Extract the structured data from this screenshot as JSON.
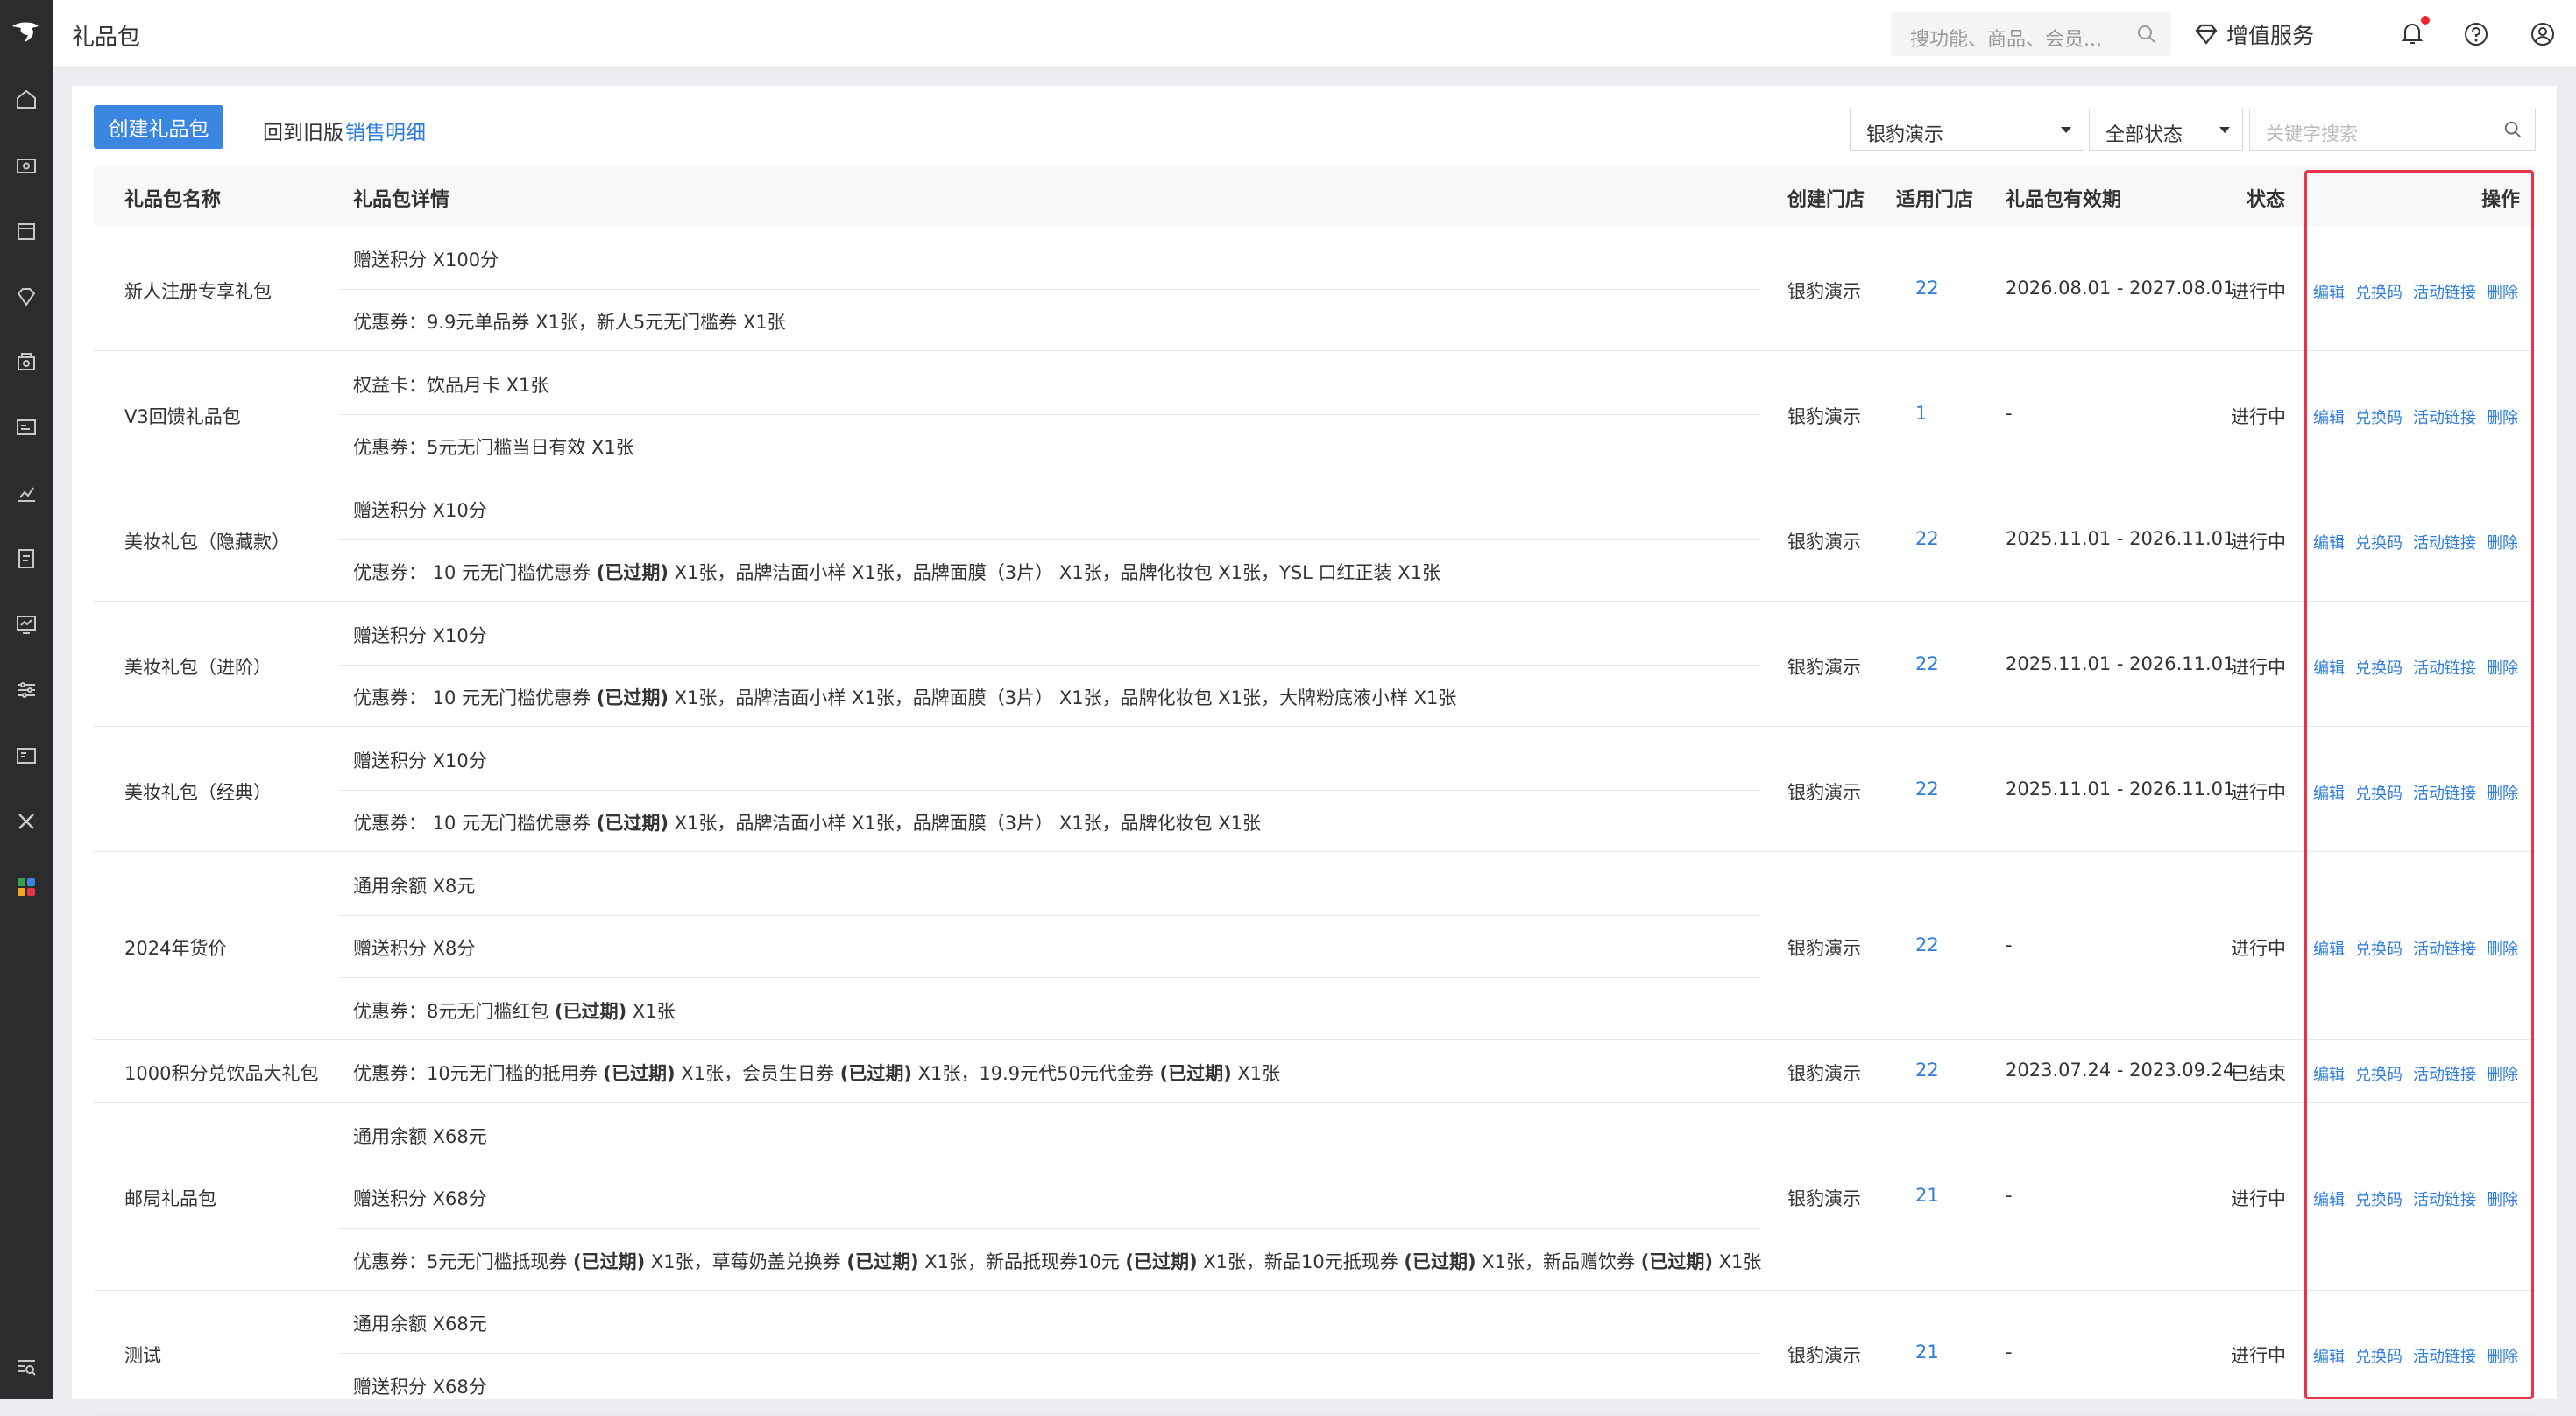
{
  "topbar": {
    "title": "礼品包",
    "search_placeholder": "搜功能、商品、会员...",
    "value_added": "增值服务"
  },
  "toolbar": {
    "create_button": "创建礼品包",
    "back_old": "回到旧版",
    "sales_detail": "销售明细",
    "store_select": "银豹演示",
    "status_select": "全部状态",
    "keyword_placeholder": "关键字搜索"
  },
  "table": {
    "headers": {
      "name": "礼品包名称",
      "detail": "礼品包详情",
      "creator_store": "创建门店",
      "applicable_stores": "适用门店",
      "validity": "礼品包有效期",
      "status": "状态",
      "actions": "操作"
    },
    "action_labels": [
      "编辑",
      "兑换码",
      "活动链接",
      "删除"
    ],
    "rows": [
      {
        "name": "新人注册专享礼包",
        "details": [
          "赠送积分 X100分",
          "优惠券：9.9元单品券 X1张，新人5元无门槛券 X1张"
        ],
        "creator": "银豹演示",
        "stores": "22",
        "validity": "2026.08.01 - 2027.08.01",
        "status": "进行中"
      },
      {
        "name": "V3回馈礼品包",
        "details": [
          "权益卡：饮品月卡 X1张",
          "优惠券：5元无门槛当日有效 X1张"
        ],
        "creator": "银豹演示",
        "stores": "1",
        "validity": "-",
        "status": "进行中"
      },
      {
        "name": "美妆礼包（隐藏款）",
        "details": [
          "赠送积分 X10分",
          "优惠券： 10 元无门槛优惠券 (已过期) X1张，品牌洁面小样 X1张，品牌面膜（3片） X1张，品牌化妆包 X1张，YSL 口红正装 X1张"
        ],
        "creator": "银豹演示",
        "stores": "22",
        "validity": "2025.11.01 - 2026.11.01",
        "status": "进行中"
      },
      {
        "name": "美妆礼包（进阶）",
        "details": [
          "赠送积分 X10分",
          "优惠券： 10 元无门槛优惠券 (已过期) X1张，品牌洁面小样 X1张，品牌面膜（3片） X1张，品牌化妆包 X1张，大牌粉底液小样 X1张"
        ],
        "creator": "银豹演示",
        "stores": "22",
        "validity": "2025.11.01 - 2026.11.01",
        "status": "进行中"
      },
      {
        "name": "美妆礼包（经典）",
        "details": [
          "赠送积分 X10分",
          "优惠券： 10 元无门槛优惠券 (已过期) X1张，品牌洁面小样 X1张，品牌面膜（3片） X1张，品牌化妆包 X1张"
        ],
        "creator": "银豹演示",
        "stores": "22",
        "validity": "2025.11.01 - 2026.11.01",
        "status": "进行中"
      },
      {
        "name": "2024年货价",
        "details": [
          "通用余额 X8元",
          "赠送积分 X8分",
          "优惠券：8元无门槛红包 (已过期) X1张"
        ],
        "creator": "银豹演示",
        "stores": "22",
        "validity": "-",
        "status": "进行中"
      },
      {
        "name": "1000积分兑饮品大礼包",
        "details": [
          "优惠券：10元无门槛的抵用券 (已过期) X1张，会员生日券 (已过期) X1张，19.9元代50元代金券 (已过期) X1张"
        ],
        "creator": "银豹演示",
        "stores": "22",
        "validity": "2023.07.24 - 2023.09.24",
        "status": "已结束"
      },
      {
        "name": "邮局礼品包",
        "details": [
          "通用余额 X68元",
          "赠送积分 X68分",
          "优惠券：5元无门槛抵现券 (已过期) X1张，草莓奶盖兑换券 (已过期) X1张，新品抵现券10元 (已过期) X1张，新品10元抵现券 (已过期) X1张，新品赠饮券 (已过期) X1张"
        ],
        "creator": "银豹演示",
        "stores": "21",
        "validity": "-",
        "status": "进行中"
      },
      {
        "name": "测试",
        "details": [
          "通用余额 X68元",
          "赠送积分 X68分"
        ],
        "creator": "银豹演示",
        "stores": "21",
        "validity": "-",
        "status": "进行中"
      }
    ]
  }
}
